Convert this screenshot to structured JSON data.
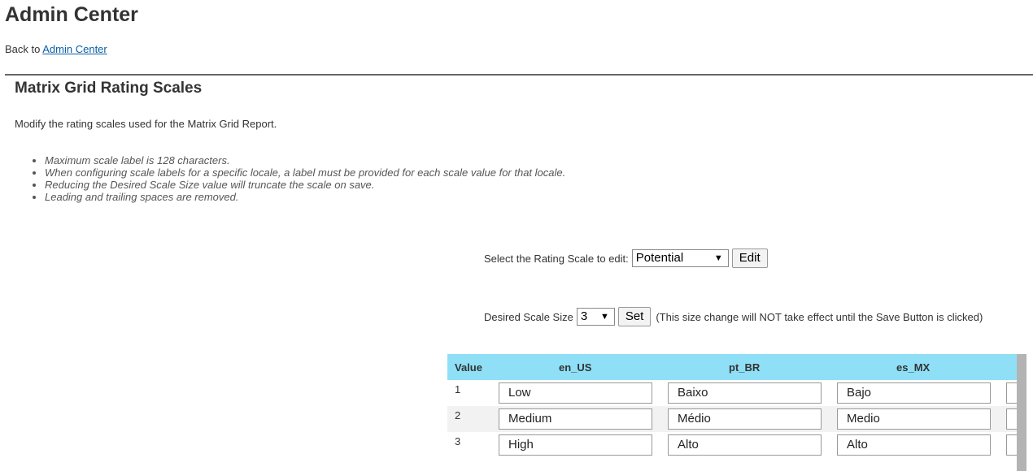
{
  "header": {
    "title": "Admin Center",
    "back_prefix": "Back to",
    "back_link": "Admin Center"
  },
  "section": {
    "title": "Matrix Grid Rating Scales",
    "description": "Modify the rating scales used for the Matrix Grid Report.",
    "notes": [
      "Maximum scale label is 128 characters.",
      "When configuring scale labels for a specific locale, a label must be provided for each scale value for that locale.",
      "Reducing the Desired Scale Size value will truncate the scale on save.",
      "Leading and trailing spaces are removed."
    ]
  },
  "scale_select": {
    "label": "Select the Rating Scale to edit:",
    "selected": "Potential",
    "edit_button": "Edit"
  },
  "scale_size": {
    "label": "Desired Scale Size",
    "selected": "3",
    "set_button": "Set",
    "hint": "(This size change will NOT take effect until the Save Button is clicked)"
  },
  "grid": {
    "header_bg": "#8fe0f7",
    "columns": [
      "Value",
      "en_US",
      "pt_BR",
      "es_MX"
    ],
    "rows": [
      {
        "value": "1",
        "en_US": "Low",
        "pt_BR": "Baixo",
        "es_MX": "Bajo"
      },
      {
        "value": "2",
        "en_US": "Medium",
        "pt_BR": "Médio",
        "es_MX": "Medio"
      },
      {
        "value": "3",
        "en_US": "High",
        "pt_BR": "Alto",
        "es_MX": "Alto"
      }
    ]
  }
}
